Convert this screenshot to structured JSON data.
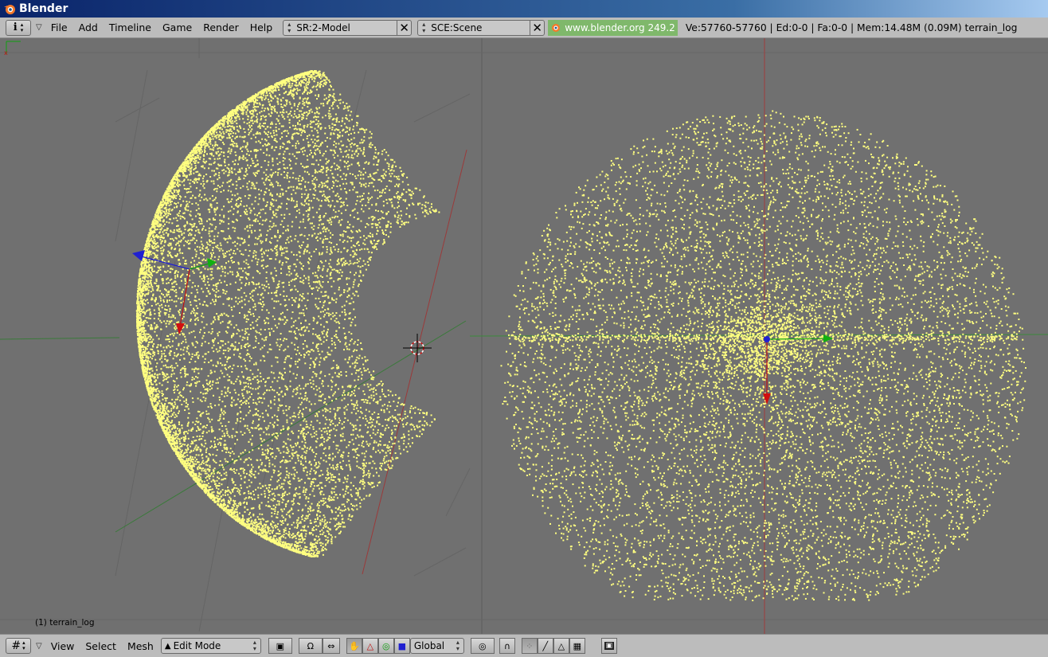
{
  "window": {
    "title": "Blender"
  },
  "header": {
    "menus": [
      "File",
      "Add",
      "Timeline",
      "Game",
      "Render",
      "Help"
    ],
    "screen": "SR:2-Model",
    "scene": "SCE:Scene",
    "website": "www.blender.org 249.2",
    "stats": "Ve:57760-57760 | Ed:0-0 | Fa:0-0 | Mem:14.48M (0.09M) terrain_log"
  },
  "viewport": {
    "object_label": "(1) terrain_log",
    "point_color": "#ffff80",
    "background": "#707070"
  },
  "footer": {
    "menus": [
      "View",
      "Select",
      "Mesh"
    ],
    "mode": "Edit Mode",
    "orientation": "Global"
  }
}
